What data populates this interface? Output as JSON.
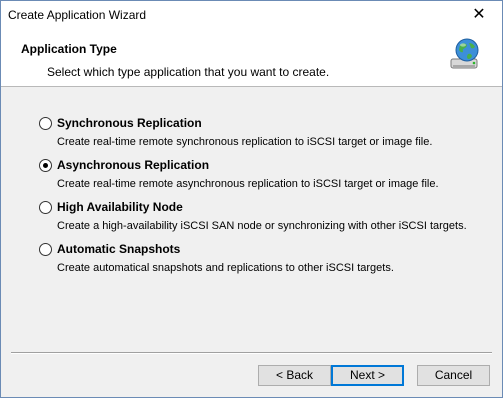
{
  "window": {
    "title": "Create Application Wizard",
    "close_symbol": "✕"
  },
  "header": {
    "title": "Application Type",
    "subtitle": "Select which type application that you want to create.",
    "icon": "globe-drive-icon"
  },
  "options": [
    {
      "label": "Synchronous Replication",
      "description": "Create real-time remote synchronous replication to iSCSI target or image file.",
      "selected": false
    },
    {
      "label": "Asynchronous Replication",
      "description": "Create real-time remote asynchronous replication to iSCSI target or image file.",
      "selected": true
    },
    {
      "label": "High Availability Node",
      "description": "Create a high-availability iSCSI SAN node or synchronizing with other iSCSI targets.",
      "selected": false
    },
    {
      "label": "Automatic Snapshots",
      "description": "Create automatical snapshots and replications to other iSCSI targets.",
      "selected": false
    }
  ],
  "buttons": {
    "back": "< Back",
    "next": "Next >",
    "cancel": "Cancel"
  }
}
